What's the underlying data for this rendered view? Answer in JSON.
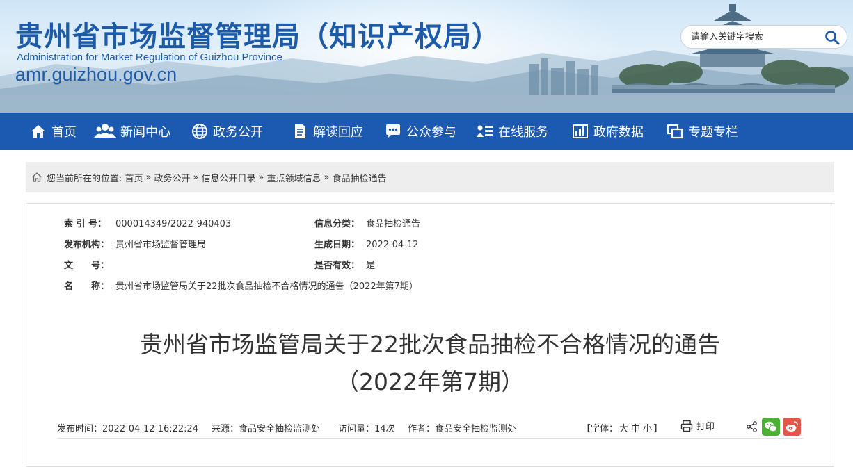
{
  "header": {
    "title_cn": "贵州省市场监督管理局（知识产权局）",
    "title_en": "Administration for Market Regulation of Guizhou Province",
    "domain": "amr.guizhou.gov.cn",
    "search_placeholder": "请输入关键字搜索"
  },
  "nav": {
    "items": [
      {
        "label": "首页",
        "icon": "home-icon"
      },
      {
        "label": "新闻中心",
        "icon": "people-icon"
      },
      {
        "label": "政务公开",
        "icon": "globe-icon"
      },
      {
        "label": "解读回应",
        "icon": "document-icon"
      },
      {
        "label": "公众参与",
        "icon": "chat-icon"
      },
      {
        "label": "在线服务",
        "icon": "user-list-icon"
      },
      {
        "label": "政府数据",
        "icon": "bar-chart-icon"
      },
      {
        "label": "专题专栏",
        "icon": "windows-icon"
      }
    ]
  },
  "breadcrumb": {
    "prefix": "您当前所在的位置:",
    "items": [
      "首页",
      "政务公开",
      "信息公开目录",
      "重点领域信息",
      "食品抽检通告"
    ],
    "separator": "»"
  },
  "meta": {
    "index_label": "索 引 号：",
    "index_value": "000014349/2022-940403",
    "category_label": "信息分类：",
    "category_value": "食品抽检通告",
    "publisher_label": "发布机构：",
    "publisher_value": "贵州省市场监督管理局",
    "date_label": "生成日期：",
    "date_value": "2022-04-12",
    "doc_label": "文　　号：",
    "doc_value": "",
    "valid_label": "是否有效：",
    "valid_value": "是",
    "name_label": "名　　称：",
    "name_value": "贵州省市场监管局关于22批次食品抽检不合格情况的通告（2022年第7期）"
  },
  "article": {
    "title_line1": "贵州省市场监管局关于22批次食品抽检不合格情况的通告",
    "title_line2": "（2022年第7期）",
    "publish_time": "发布时间：2022-04-12 16:22:24",
    "source": "来源：食品安全抽检监测处",
    "views": "访问量：14次",
    "author": "作者：食品安全抽检监测处",
    "font_prefix": "【字体：",
    "font_large": "大",
    "font_medium": "中",
    "font_small": "小",
    "font_suffix": "】",
    "print_label": "打印"
  },
  "colors": {
    "brand_blue": "#1b5ab0",
    "title_blue": "#1d5aa8",
    "wechat_green": "#4cb035",
    "weibo_red": "#e1574a"
  }
}
